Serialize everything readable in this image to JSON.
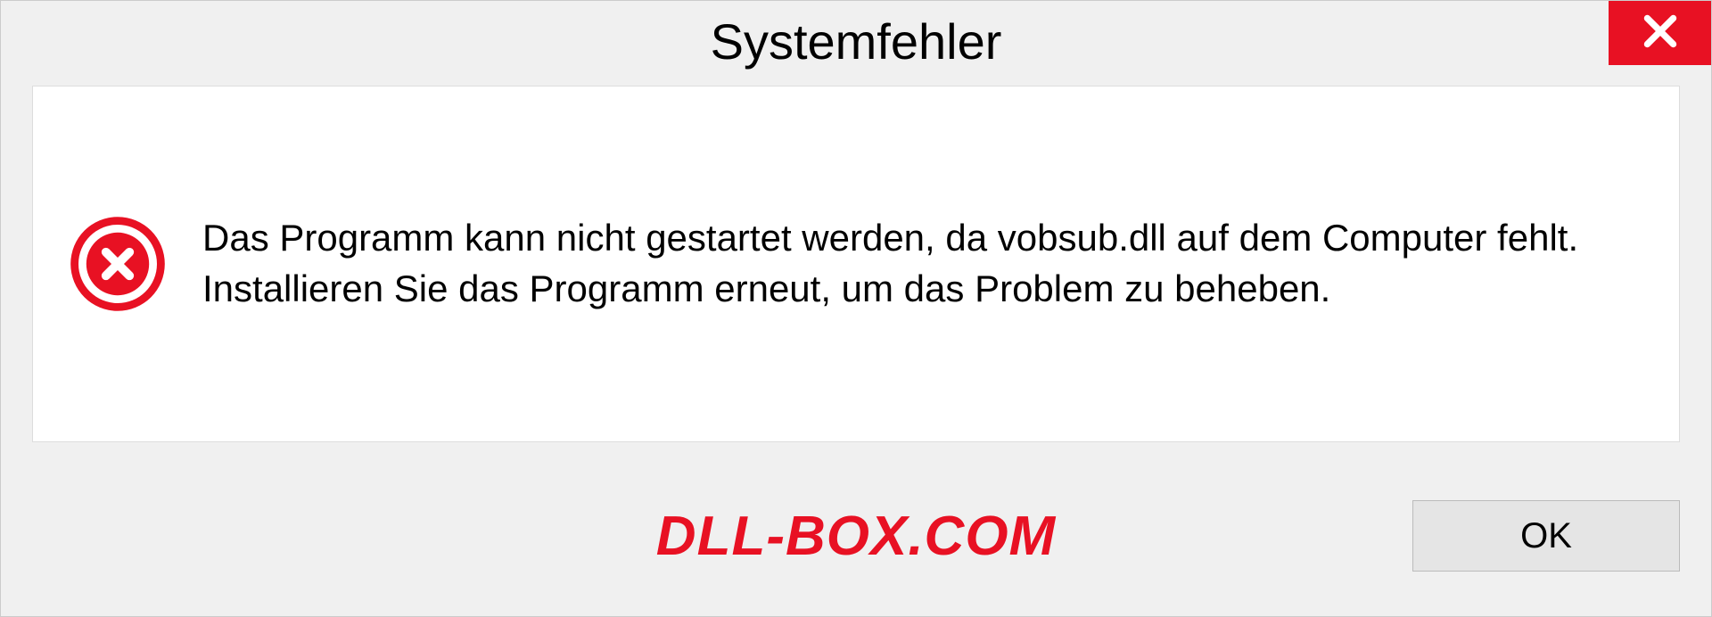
{
  "dialog": {
    "title": "Systemfehler",
    "message": "Das Programm kann nicht gestartet werden, da vobsub.dll auf dem Computer fehlt. Installieren Sie das Programm erneut, um das Problem zu beheben.",
    "ok_label": "OK"
  },
  "watermark": "DLL-BOX.COM"
}
